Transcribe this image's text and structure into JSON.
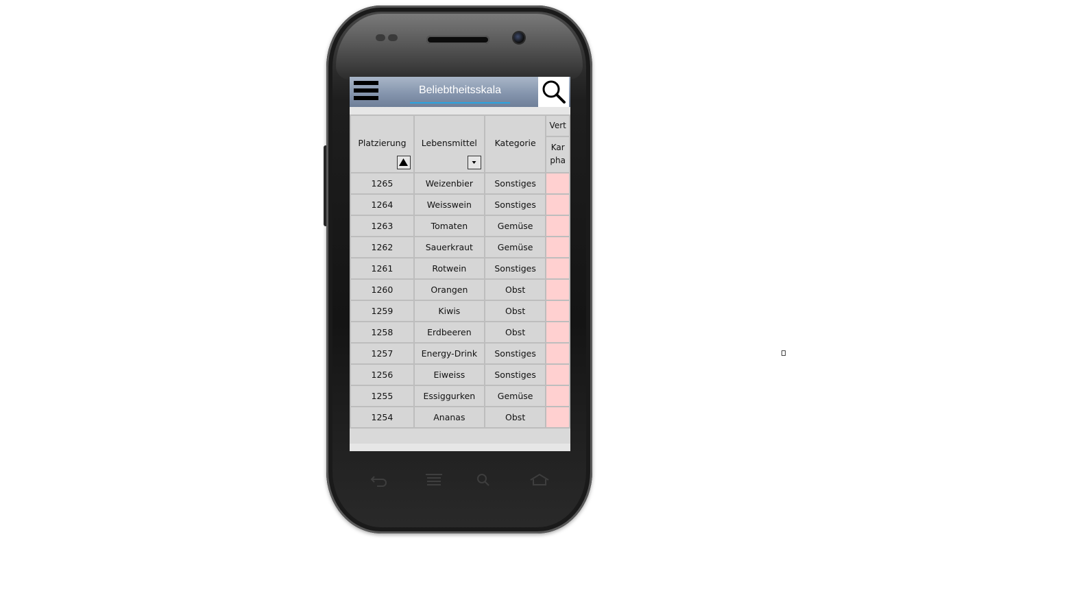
{
  "app": {
    "title": "Beliebtheitsskala"
  },
  "icons": {
    "menu": "hamburger-menu-icon",
    "search": "search-icon",
    "sort_asc": "triangle-up-icon",
    "dropdown": "chevron-down-icon"
  },
  "table": {
    "headers": {
      "platzierung": "Platzierung",
      "lebensmittel": "Lebensmittel",
      "kategorie": "Kategorie",
      "extra_top": "Vert",
      "extra_bottom_1": "Kar",
      "extra_bottom_2": "pha"
    },
    "rows": [
      {
        "platz": "1265",
        "name": "Weizenbier",
        "kat": "Sonstiges"
      },
      {
        "platz": "1264",
        "name": "Weisswein",
        "kat": "Sonstiges"
      },
      {
        "platz": "1263",
        "name": "Tomaten",
        "kat": "Gemüse"
      },
      {
        "platz": "1262",
        "name": "Sauerkraut",
        "kat": "Gemüse"
      },
      {
        "platz": "1261",
        "name": "Rotwein",
        "kat": "Sonstiges"
      },
      {
        "platz": "1260",
        "name": "Orangen",
        "kat": "Obst"
      },
      {
        "platz": "1259",
        "name": "Kiwis",
        "kat": "Obst"
      },
      {
        "platz": "1258",
        "name": "Erdbeeren",
        "kat": "Obst"
      },
      {
        "platz": "1257",
        "name": "Energy-Drink",
        "kat": "Sonstiges"
      },
      {
        "platz": "1256",
        "name": "Eiweiss",
        "kat": "Sonstiges"
      },
      {
        "platz": "1255",
        "name": "Essiggurken",
        "kat": "Gemüse"
      },
      {
        "platz": "1254",
        "name": "Ananas",
        "kat": "Obst"
      }
    ]
  },
  "colors": {
    "appbar": "#8595ad",
    "highlight_cell": "#ffd0d0",
    "title_underline": "#2aa4e0"
  },
  "device_nav": {
    "back": "back-icon",
    "menu": "menu-lines-icon",
    "search": "search-icon",
    "home": "home-icon"
  }
}
